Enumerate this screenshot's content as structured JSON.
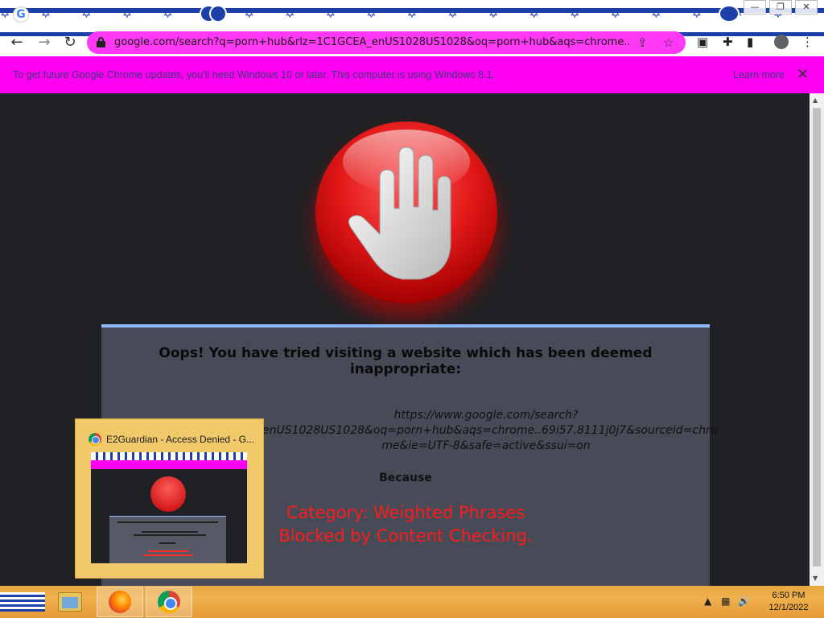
{
  "browser": {
    "tab_favicon": "G",
    "url": "google.com/search?q=porn+hub&rlz=1C1GCEA_enUS1028US1028&oq=porn+hub&aqs=chrome..69i...",
    "icons": [
      "back-icon",
      "forward-icon",
      "reload-icon",
      "lock-icon",
      "share-icon",
      "star-icon",
      "extension-icon",
      "puzzle-icon",
      "sidebar-icon",
      "profile-icon",
      "menu-icon"
    ]
  },
  "infobar": {
    "message": "To get future Google Chrome updates, you'll need Windows 10 or later. This computer is using Windows 8.1.",
    "learn_more": "Learn more",
    "close": "✕"
  },
  "blockpage": {
    "heading": "Oops! You have tried visiting a website which has been deemed inappropriate:",
    "url_line1": "https://www.google.com/search?",
    "url_line2": "enUS1028US1028&oq=porn+hub&aqs=chrome..69i57.8111j0j7&sourceid=chro",
    "url_line3": "me&ie=UTF-8&safe=active&ssui=on",
    "because": "Because",
    "reason_line1": "Category: Weighted Phrases",
    "reason_line2": "Blocked by Content Checking."
  },
  "preview": {
    "title": "E2Guardian - Access Denied - G..."
  },
  "taskbar": {
    "apps": [
      "file-explorer",
      "firefox",
      "chrome"
    ],
    "time": "6:50 PM",
    "date": "12/1/2022"
  },
  "colors": {
    "accent_magenta": "#ff00f3",
    "theme_blue": "#1c3faa",
    "reason_red": "#ff1a1a",
    "taskbar_orange": "#f0b04e"
  }
}
